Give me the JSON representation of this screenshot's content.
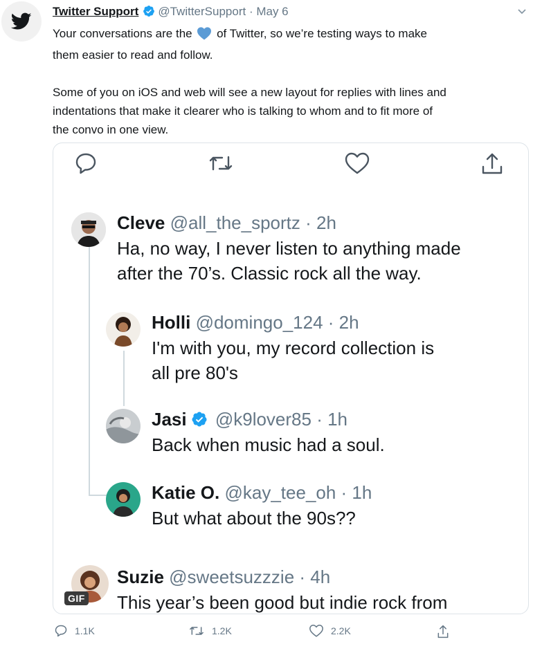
{
  "author": {
    "name": "Twitter Support",
    "handle": "@TwitterSupport",
    "date": "· May 6"
  },
  "tweet": {
    "line1_pre": "Your conversations are the ",
    "line1_post": " of Twitter, so we’re testing ways to make",
    "line2": "them easier to read and follow.",
    "para2_l1": "Some of you on iOS and web will see a new layout for replies with lines and",
    "para2_l2": "indentations that make it clearer who is talking to whom and to fit more of",
    "para2_l3": "the convo in one view."
  },
  "replies": [
    {
      "name": "Cleve",
      "handle": "@all_the_sportz · 2h",
      "line1": "Ha, no way, I never listen to anything made",
      "line2": "after the 70’s. Classic rock all the way."
    },
    {
      "name": "Holli",
      "handle": "@domingo_124 · 2h",
      "line1": "I'm with you, my record collection is",
      "line2": "all pre 80's"
    },
    {
      "name": "Jasi",
      "handle": "@k9lover85 · 1h",
      "line1": "Back when music had a soul."
    },
    {
      "name": "Katie O.",
      "handle": "@kay_tee_oh · 1h",
      "line1": "But what about the 90s??"
    },
    {
      "name": "Suzie",
      "handle": "@sweetsuzzzie · 4h",
      "line1": "This year’s been good but indie rock from",
      "badge": "GIF"
    }
  ],
  "stats": {
    "replies": "1.1K",
    "retweets": "1.2K",
    "likes": "2.2K"
  },
  "colors": {
    "accent": "#1da1f2",
    "muted": "#657786",
    "heart": "#5b9bd5"
  },
  "icons": [
    "twitter-bird-icon",
    "verified-badge-icon",
    "blue-heart-emoji",
    "reply-icon",
    "retweet-icon",
    "like-icon",
    "share-icon",
    "chevron-down-icon"
  ]
}
